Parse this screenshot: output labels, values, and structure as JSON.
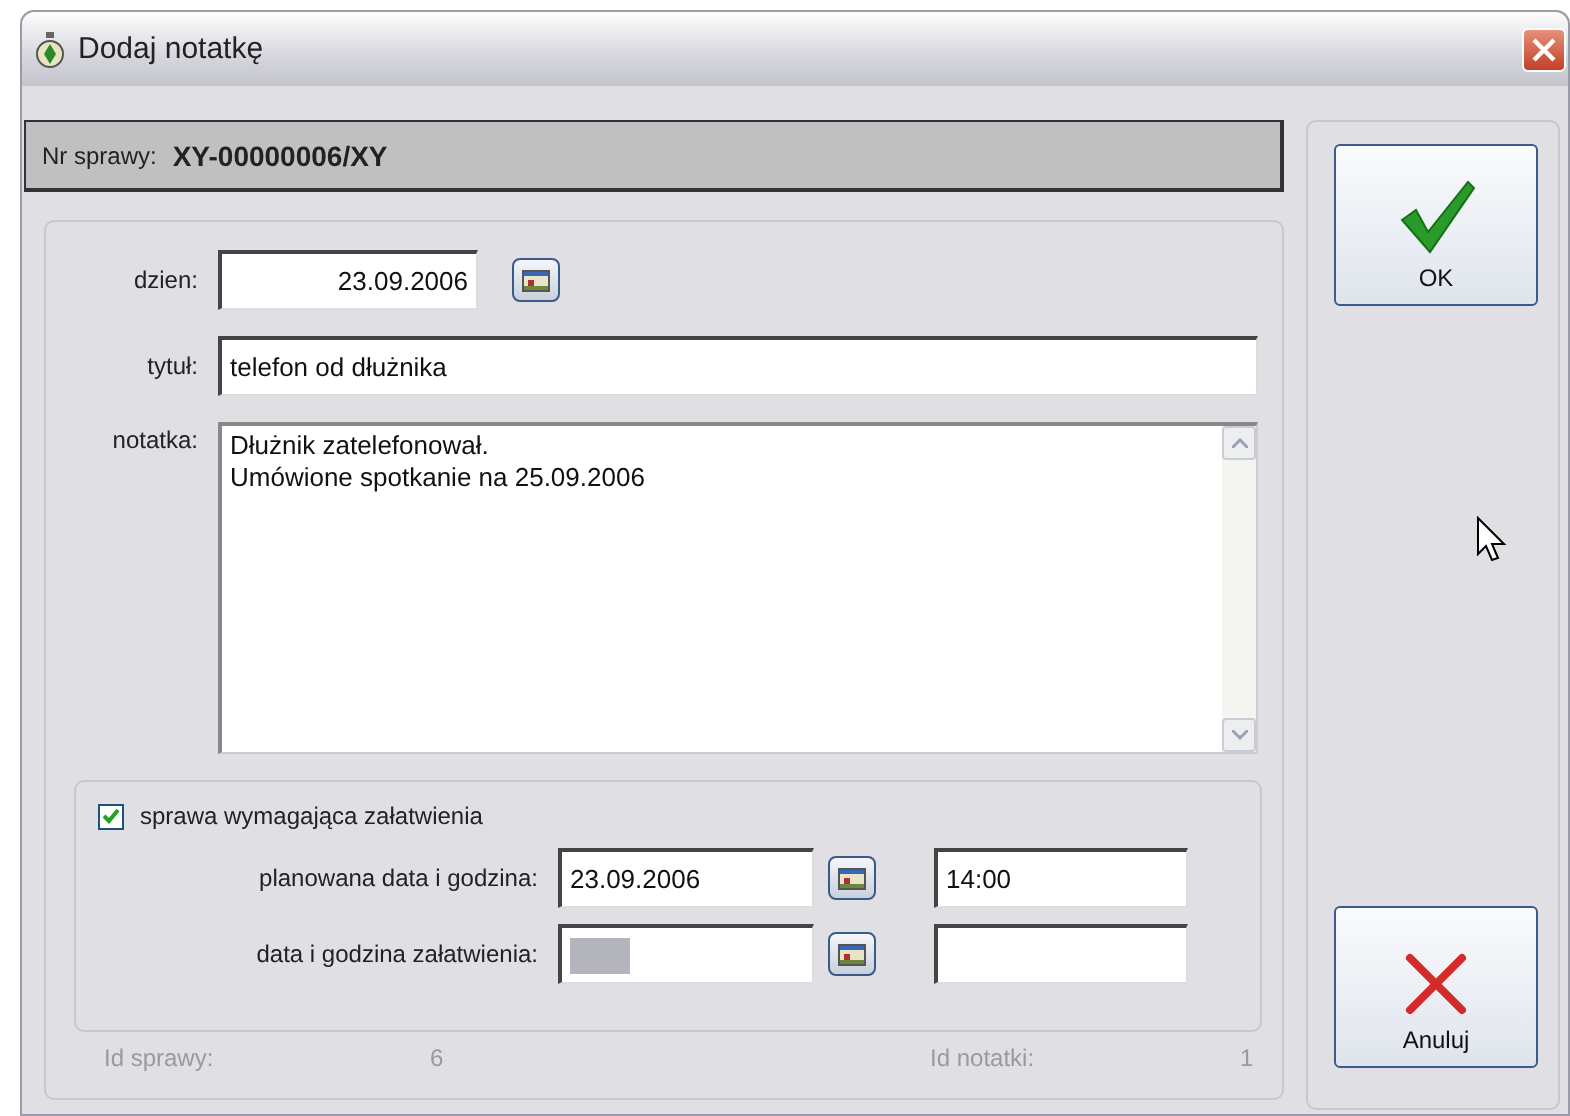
{
  "window": {
    "title": "Dodaj notatkę"
  },
  "case_number": {
    "label": "Nr sprawy:",
    "value": "XY-00000006/XY"
  },
  "day": {
    "label": "dzien:",
    "value": "23.09.2006"
  },
  "subject": {
    "label": "tytuł:",
    "value": "telefon od dłużnika"
  },
  "note": {
    "label": "notatka:",
    "text": "Dłużnik zatelefonował.\nUmówione spotkanie na 25.09.2006"
  },
  "task": {
    "label": "sprawa wymagająca załatwienia",
    "checked": true,
    "rows": [
      {
        "label": "planowana data i godzina:",
        "date": "23.09.2006",
        "time": "14:00",
        "blank": false
      },
      {
        "label": "data i godzina załatwienia:",
        "blank": true
      }
    ]
  },
  "footer": [
    {
      "label": "Id sprawy:",
      "value": "6"
    },
    {
      "label": "Id notatki:",
      "value": "1"
    }
  ],
  "buttons": [
    {
      "label": "OK",
      "kind": "ok"
    },
    {
      "label": "Anuluj",
      "kind": "cancel"
    }
  ]
}
